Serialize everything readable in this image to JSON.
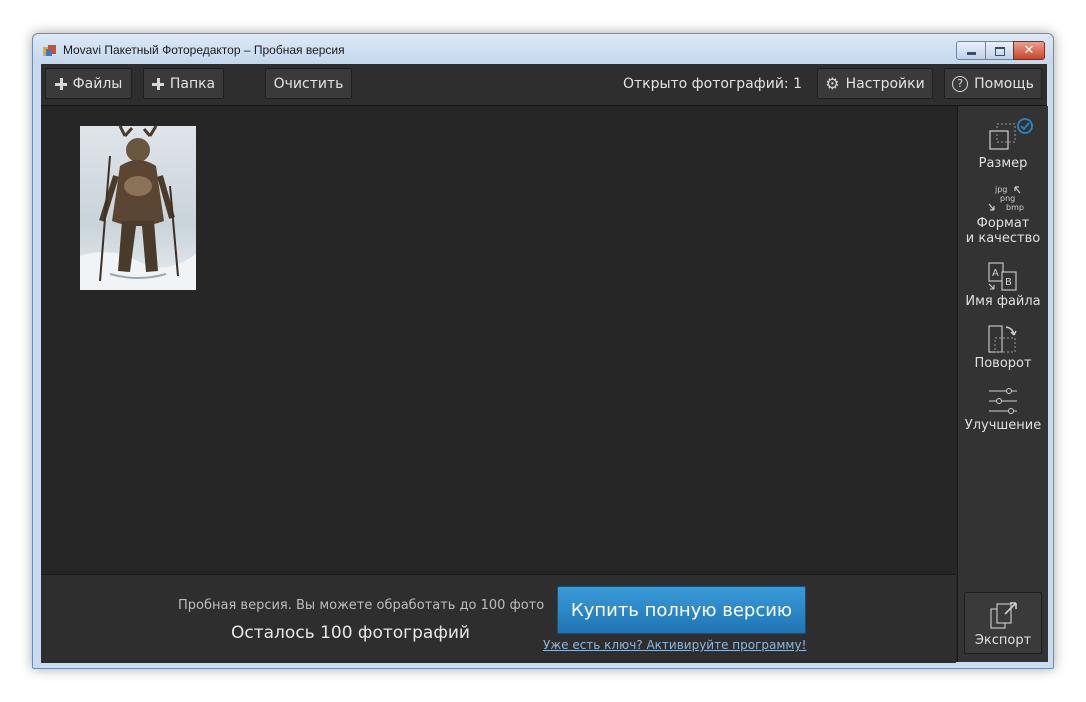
{
  "window": {
    "title": "Movavi Пакетный Фоторедактор – Пробная версия",
    "close_glyph": "✕"
  },
  "toolbar": {
    "files_label": "Файлы",
    "folder_label": "Папка",
    "clear_label": "Очистить",
    "open_count": "Открыто фотографий: 1",
    "settings_label": "Настройки",
    "help_label": "Помощь",
    "help_glyph": "?",
    "settings_glyph": "⚙"
  },
  "sidebar": {
    "items": [
      {
        "label": "Размер",
        "icon": "resize-icon"
      },
      {
        "label": "Формат\nи качество",
        "icon": "format-icon",
        "formats": [
          "jpg",
          "png",
          "bmp"
        ]
      },
      {
        "label": "Имя файла",
        "icon": "rename-icon",
        "letters": [
          "A",
          "B"
        ]
      },
      {
        "label": "Поворот",
        "icon": "rotate-icon"
      },
      {
        "label": "Улучшение",
        "icon": "adjust-icon"
      }
    ],
    "export_label": "Экспорт"
  },
  "bottom": {
    "trial_note": "Пробная версия. Вы можете обработать до 100 фото",
    "remaining": "Осталось 100 фотографий",
    "buy_label": "Купить полную версию",
    "activate_link": "Уже есть ключ? Активируйте программу!"
  },
  "colors": {
    "accent": "#2a86c6",
    "background": "#262626",
    "panel": "#333333"
  }
}
